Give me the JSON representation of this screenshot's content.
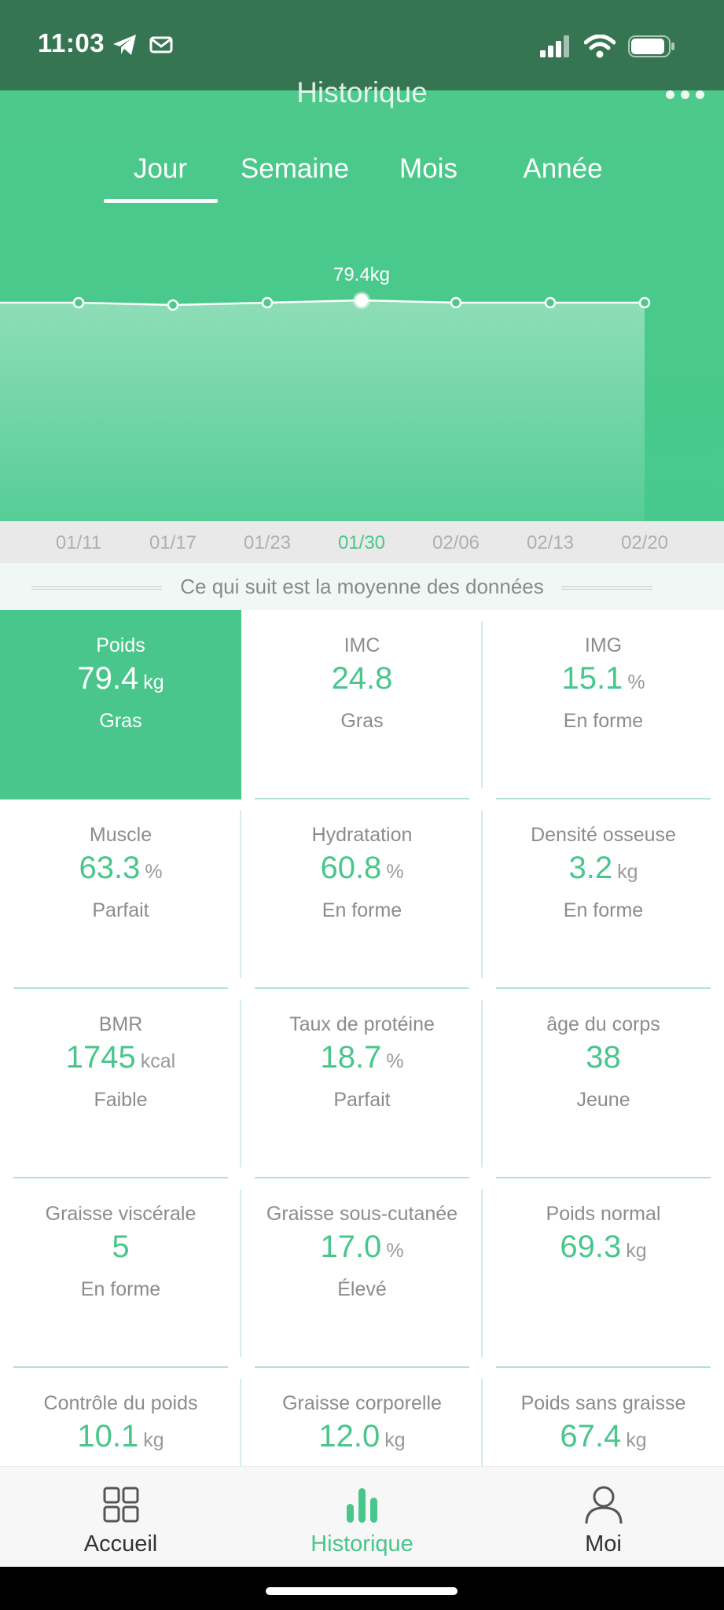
{
  "status_bar": {
    "time": "11:03",
    "icons_left": [
      "telegram-icon",
      "mail-icon"
    ],
    "icons_right": [
      "cellular-signal-icon",
      "wifi-icon",
      "battery-icon"
    ]
  },
  "header": {
    "title": "Historique",
    "more_icon": "more-horizontal-icon"
  },
  "tabs": [
    {
      "label": "Jour",
      "active": true
    },
    {
      "label": "Semaine",
      "active": false
    },
    {
      "label": "Mois",
      "active": false
    },
    {
      "label": "Année",
      "active": false
    }
  ],
  "chart_data": {
    "type": "area",
    "categories": [
      "01/11",
      "01/17",
      "01/23",
      "01/30",
      "02/06",
      "02/13",
      "02/20"
    ],
    "values": [
      79.3,
      79.2,
      79.3,
      79.4,
      79.3,
      79.3,
      79.3
    ],
    "selected_index": 3,
    "selected_label": "79.4kg",
    "ylim": [
      0,
      80
    ]
  },
  "average_banner": "Ce qui suit est la moyenne des données",
  "metrics": [
    {
      "name": "Poids",
      "value": "79.4",
      "unit": "kg",
      "status": "Gras",
      "selected": true
    },
    {
      "name": "IMC",
      "value": "24.8",
      "unit": "",
      "status": "Gras"
    },
    {
      "name": "IMG",
      "value": "15.1",
      "unit": "%",
      "status": "En forme"
    },
    {
      "name": "Muscle",
      "value": "63.3",
      "unit": "%",
      "status": "Parfait"
    },
    {
      "name": "Hydratation",
      "value": "60.8",
      "unit": "%",
      "status": "En forme"
    },
    {
      "name": "Densité osseuse",
      "value": "3.2",
      "unit": "kg",
      "status": "En forme"
    },
    {
      "name": "BMR",
      "value": "1745",
      "unit": "kcal",
      "status": "Faible"
    },
    {
      "name": "Taux de protéine",
      "value": "18.7",
      "unit": "%",
      "status": "Parfait"
    },
    {
      "name": "âge du corps",
      "value": "38",
      "unit": "",
      "status": "Jeune"
    },
    {
      "name": "Graisse viscérale",
      "value": "5",
      "unit": "",
      "status": "En forme"
    },
    {
      "name": "Graisse sous-cutanée",
      "value": "17.0",
      "unit": "%",
      "status": "Élevé"
    },
    {
      "name": "Poids normal",
      "value": "69.3",
      "unit": "kg",
      "status": ""
    },
    {
      "name": "Contrôle du poids",
      "value": "10.1",
      "unit": "kg",
      "status": ""
    },
    {
      "name": "Graisse corporelle",
      "value": "12.0",
      "unit": "kg",
      "status": ""
    },
    {
      "name": "Poids sans graisse",
      "value": "67.4",
      "unit": "kg",
      "status": ""
    }
  ],
  "bottom_nav": [
    {
      "label": "Accueil",
      "icon": "grid-home-icon",
      "active": false
    },
    {
      "label": "Historique",
      "icon": "bar-chart-icon",
      "active": true
    },
    {
      "label": "Moi",
      "icon": "user-icon",
      "active": false
    }
  ],
  "colors": {
    "accent": "#49c68b",
    "status_bar": "#357552",
    "text_muted": "#8c8c8c"
  }
}
